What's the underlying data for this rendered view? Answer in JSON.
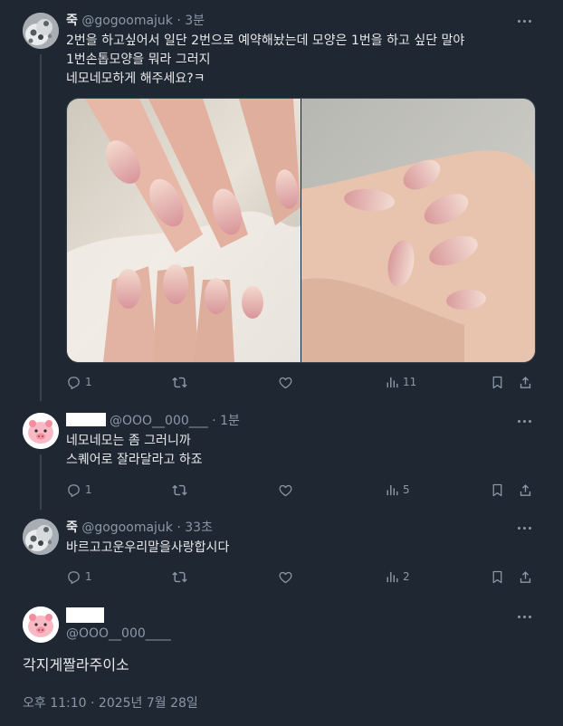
{
  "tweet1": {
    "name": "죽",
    "handle": "@gogoomajuk",
    "time": "· 3분",
    "lines": [
      "2번을 하고싶어서 일단 2번으로 예약해놨는데 모양은 1번을 하고 싶단 말야",
      "1번손톱모양을 뭐라 그러지",
      "네모네모하게 해주세요?ㅋ"
    ],
    "replies": "1",
    "views": "11"
  },
  "tweet2": {
    "handle": "@OOO__000___",
    "time": "· 1분",
    "lines": [
      "네모네모는 좀 그러니까",
      "스퀘어로 잘라달라고 하죠"
    ],
    "replies": "1",
    "views": "5"
  },
  "tweet3": {
    "name": "죽",
    "handle": "@gogoomajuk",
    "time": "· 33초",
    "lines": [
      "바르고고운우리말을사랑합시다"
    ],
    "replies": "1",
    "views": "2"
  },
  "main": {
    "handle": "@OOO__000____",
    "text": "각지게짤라주이소",
    "timestamp": "오후 11:10 · 2025년 7월 28일"
  },
  "colors": {
    "background": "#1e2732",
    "text": "#e7e9ea",
    "secondary": "#8b98a5",
    "thread_line": "#38444d"
  },
  "icons": [
    "reply-icon",
    "retweet-icon",
    "like-icon",
    "views-icon",
    "bookmark-icon",
    "share-icon",
    "more-icon"
  ]
}
